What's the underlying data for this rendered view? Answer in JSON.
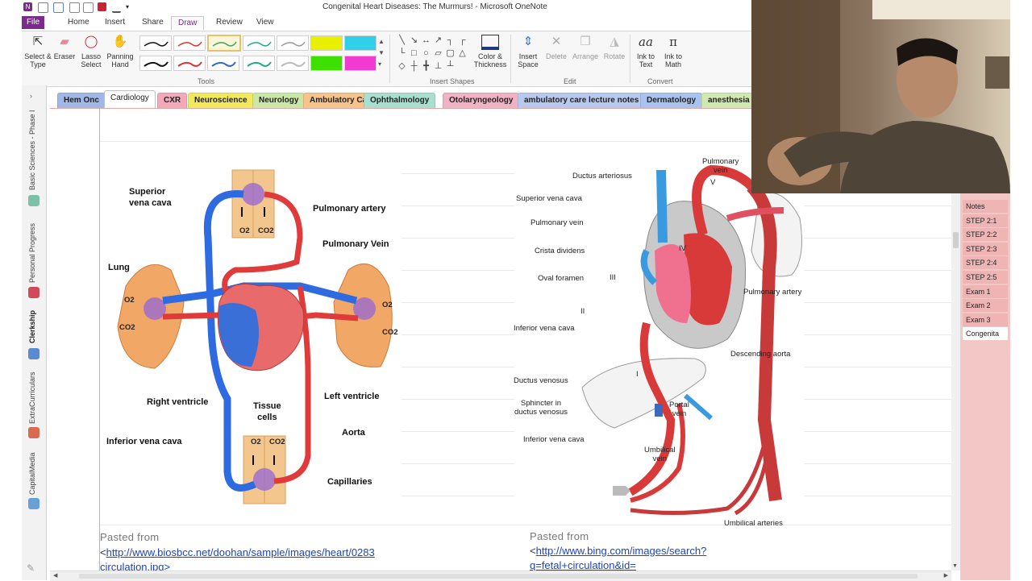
{
  "window": {
    "title": "Congenital Heart Diseases: The Murmurs! - Microsoft OneNote"
  },
  "ribbon_tabs": [
    {
      "label": "File"
    },
    {
      "label": "Home"
    },
    {
      "label": "Insert"
    },
    {
      "label": "Share"
    },
    {
      "label": "Draw"
    },
    {
      "label": "Review"
    },
    {
      "label": "View"
    }
  ],
  "ribbon": {
    "select_type": "Select & Type",
    "eraser": "Eraser",
    "lasso": "Lasso Select",
    "panning": "Panning Hand",
    "color_thickness": "Color & Thickness",
    "insert_space": "Insert Space",
    "delete": "Delete",
    "arrange": "Arrange",
    "rotate": "Rotate",
    "ink_to_text": "Ink to Text",
    "ink_to_math": "Ink to Math",
    "groups": {
      "tools": "Tools",
      "insert_shapes": "Insert Shapes",
      "edit": "Edit",
      "convert": "Convert"
    }
  },
  "notebooks": [
    {
      "label": "Basic Sciences - Phase I"
    },
    {
      "label": "Personal Progress"
    },
    {
      "label": "Clerkship"
    },
    {
      "label": "ExtraCurriculars"
    },
    {
      "label": "CapitalMedia"
    }
  ],
  "sections": [
    {
      "label": "Hem Onc",
      "color": "#9fb8e8"
    },
    {
      "label": "Cardiology",
      "color": "#ffffff"
    },
    {
      "label": "CXR",
      "color": "#f4a9b8"
    },
    {
      "label": "Neuroscience",
      "color": "#f2e85c"
    },
    {
      "label": "Neurology",
      "color": "#c9e8a6"
    },
    {
      "label": "Ambulatory Care",
      "color": "#f6c48a"
    },
    {
      "label": "Ophthalmology",
      "color": "#a8e0d0"
    },
    {
      "label": "Otolaryngeology",
      "color": "#f2b2c6"
    },
    {
      "label": "ambulatory care lecture notes",
      "color": "#b8c9f0"
    },
    {
      "label": "Dermatology",
      "color": "#a9c3ef"
    },
    {
      "label": "anesthesia",
      "color": "#cfe9b0"
    }
  ],
  "pages": [
    {
      "label": "Notes"
    },
    {
      "label": "STEP 2:1"
    },
    {
      "label": "STEP 2:2"
    },
    {
      "label": "STEP 2:3"
    },
    {
      "label": "STEP 2:4"
    },
    {
      "label": "STEP 2:5"
    },
    {
      "label": "Exam 1"
    },
    {
      "label": "Exam 2"
    },
    {
      "label": "Exam 3"
    },
    {
      "label": "Congenita"
    }
  ],
  "diagram_left": {
    "labels": {
      "svc": "Superior\nvena cava",
      "pulm_artery": "Pulmonary artery",
      "pulm_vein": "Pulmonary Vein",
      "lung": "Lung",
      "o2": "O2",
      "co2": "CO2",
      "right_ventricle": "Right ventricle",
      "left_ventricle": "Left ventricle",
      "tissue_cells": "Tissue\ncells",
      "aorta": "Aorta",
      "ivc": "Inferior vena cava",
      "capillaries": "Capillaries"
    },
    "pasted_from": "Pasted from",
    "link_open": "<",
    "link_1": "http://www.biosbcc.net/doohan/sample/images/heart/0283",
    "link_2": "circulation.jpg>"
  },
  "diagram_right": {
    "labels": {
      "pulm_vein_top": "Pulmonary\nvein",
      "ductus_arteriosus": "Ductus arteriosus",
      "svc": "Superior vena cava",
      "pulm_vein": "Pulmonary vein",
      "crista": "Crista dividens",
      "oval": "Oval foramen",
      "pulm_artery": "Pulmonary artery",
      "ivc": "Inferior vena cava",
      "desc_aorta": "Descending aorta",
      "ductus_venosus": "Ductus venosus",
      "sphincter": "Sphincter in\nductus venosus",
      "portal": "Portal\nvein",
      "ivc2": "Inferior vena cava",
      "umb_vein": "Umbilical\nvein",
      "umb_arteries": "Umbilical arteries",
      "r1": "I",
      "r2": "II",
      "r3": "III",
      "r4": "IV",
      "r5": "V"
    },
    "pasted_from": "Pasted from",
    "link_open": "<",
    "link_1": "http://www.bing.com/images/search?",
    "link_2": "q=fetal+circulation&id="
  }
}
